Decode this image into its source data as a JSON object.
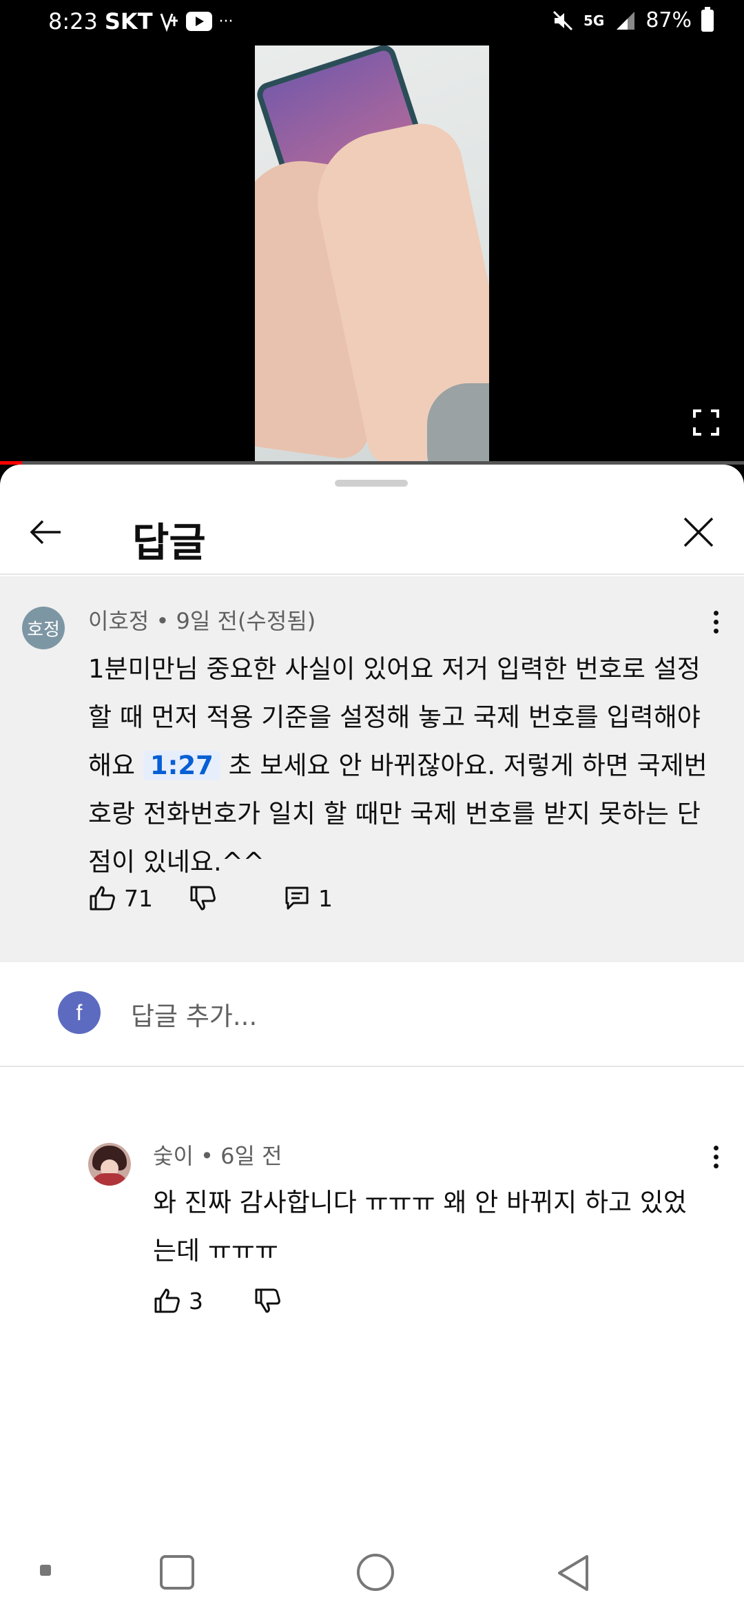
{
  "status_bar": {
    "time": "8:23",
    "carrier": "SKT",
    "extra": "···",
    "network": "5G",
    "battery": "87%"
  },
  "video": {
    "progress_fraction": 0.03,
    "progress_color": "#ff0000"
  },
  "sheet": {
    "title": "답글"
  },
  "parent_comment": {
    "avatar_text": "호정",
    "meta": "이호정 • 9일 전(수정됨)",
    "body_before": "1분미만님 중요한 사실이 있어요 저거 입력한 번호로 설정할 때 먼저 적용 기준을 설정해 놓고 국제 번호를 입력해야 해요 ",
    "timestamp": "1:27",
    "body_after": " 초 보세요 안 바뀌잖아요. 저렇게 하면 국제번호랑 전화번호가 일치 할 때만 국제 번호를 받지 못하는 단점이 있네요.^^",
    "likes": "71",
    "replies": "1"
  },
  "add_reply": {
    "avatar_letter": "f",
    "placeholder": "답글 추가...",
    "avatar_color": "#5c6bc0"
  },
  "reply": {
    "meta": "숯이 • 6일 전",
    "body": "와 진짜 감사합니다 ㅠㅠㅠ 왜 안 바뀌지 하고 있었는데 ㅠㅠㅠ",
    "likes": "3"
  },
  "colors": {
    "link_blue": "#065fd4",
    "comment_bg": "#f0f0f0"
  }
}
